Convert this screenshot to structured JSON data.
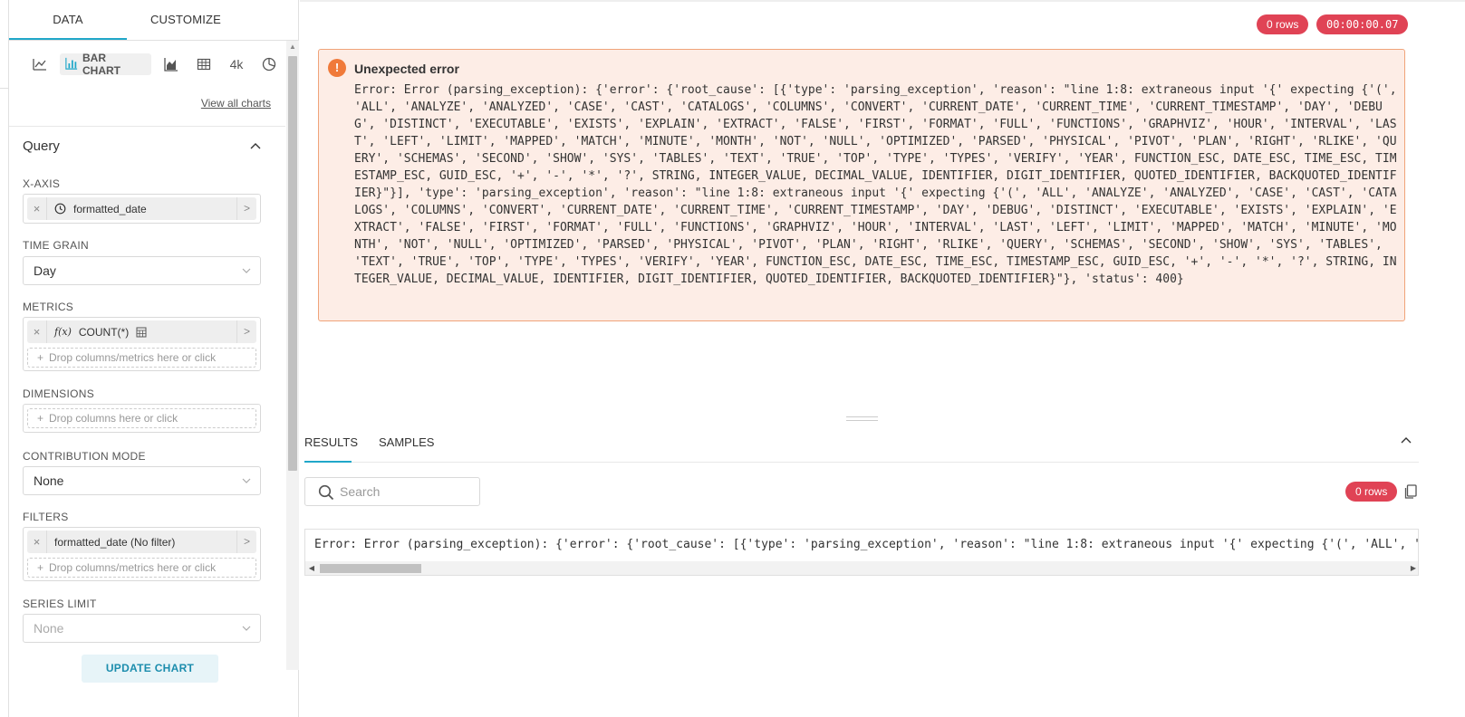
{
  "panel": {
    "tabs": [
      "DATA",
      "CUSTOMIZE"
    ],
    "chart_types": {
      "active_label": "BAR CHART",
      "four_k": "4k"
    },
    "view_all": "View all charts",
    "section_title": "Query",
    "x_axis": {
      "label": "X-AXIS",
      "value": "formatted_date"
    },
    "time_grain": {
      "label": "TIME GRAIN",
      "value": "Day"
    },
    "metrics": {
      "label": "METRICS",
      "fx": "f(x)",
      "value": "COUNT(*)",
      "drop": "Drop columns/metrics here or click"
    },
    "dimensions": {
      "label": "DIMENSIONS",
      "drop": "Drop columns here or click"
    },
    "contribution": {
      "label": "CONTRIBUTION MODE",
      "value": "None"
    },
    "filters": {
      "label": "FILTERS",
      "value": "formatted_date (No filter)",
      "drop": "Drop columns/metrics here or click"
    },
    "series_limit": {
      "label": "SERIES LIMIT",
      "placeholder": "None"
    },
    "update_button": "UPDATE CHART"
  },
  "header": {
    "rows_badge": "0 rows",
    "timer": "00:00:00.07"
  },
  "error": {
    "title": "Unexpected error",
    "message": "Error: Error (parsing_exception): {'error': {'root_cause': [{'type': 'parsing_exception', 'reason': \"line 1:8: extraneous input '{' expecting {'(', 'ALL', 'ANALYZE', 'ANALYZED', 'CASE', 'CAST', 'CATALOGS', 'COLUMNS', 'CONVERT', 'CURRENT_DATE', 'CURRENT_TIME', 'CURRENT_TIMESTAMP', 'DAY', 'DEBUG', 'DISTINCT', 'EXECUTABLE', 'EXISTS', 'EXPLAIN', 'EXTRACT', 'FALSE', 'FIRST', 'FORMAT', 'FULL', 'FUNCTIONS', 'GRAPHVIZ', 'HOUR', 'INTERVAL', 'LAST', 'LEFT', 'LIMIT', 'MAPPED', 'MATCH', 'MINUTE', 'MONTH', 'NOT', 'NULL', 'OPTIMIZED', 'PARSED', 'PHYSICAL', 'PIVOT', 'PLAN', 'RIGHT', 'RLIKE', 'QUERY', 'SCHEMAS', 'SECOND', 'SHOW', 'SYS', 'TABLES', 'TEXT', 'TRUE', 'TOP', 'TYPE', 'TYPES', 'VERIFY', 'YEAR', FUNCTION_ESC, DATE_ESC, TIME_ESC, TIMESTAMP_ESC, GUID_ESC, '+', '-', '*', '?', STRING, INTEGER_VALUE, DECIMAL_VALUE, IDENTIFIER, DIGIT_IDENTIFIER, QUOTED_IDENTIFIER, BACKQUOTED_IDENTIFIER}\"}], 'type': 'parsing_exception', 'reason': \"line 1:8: extraneous input '{' expecting {'(', 'ALL', 'ANALYZE', 'ANALYZED', 'CASE', 'CAST', 'CATALOGS', 'COLUMNS', 'CONVERT', 'CURRENT_DATE', 'CURRENT_TIME', 'CURRENT_TIMESTAMP', 'DAY', 'DEBUG', 'DISTINCT', 'EXECUTABLE', 'EXISTS', 'EXPLAIN', 'EXTRACT', 'FALSE', 'FIRST', 'FORMAT', 'FULL', 'FUNCTIONS', 'GRAPHVIZ', 'HOUR', 'INTERVAL', 'LAST', 'LEFT', 'LIMIT', 'MAPPED', 'MATCH', 'MINUTE', 'MONTH', 'NOT', 'NULL', 'OPTIMIZED', 'PARSED', 'PHYSICAL', 'PIVOT', 'PLAN', 'RIGHT', 'RLIKE', 'QUERY', 'SCHEMAS', 'SECOND', 'SHOW', 'SYS', 'TABLES', 'TEXT', 'TRUE', 'TOP', 'TYPE', 'TYPES', 'VERIFY', 'YEAR', FUNCTION_ESC, DATE_ESC, TIME_ESC, TIMESTAMP_ESC, GUID_ESC, '+', '-', '*', '?', STRING, INTEGER_VALUE, DECIMAL_VALUE, IDENTIFIER, DIGIT_IDENTIFIER, QUOTED_IDENTIFIER, BACKQUOTED_IDENTIFIER}\"}, 'status': 400}"
  },
  "results": {
    "tabs": [
      "RESULTS",
      "SAMPLES"
    ],
    "search_placeholder": "Search",
    "rows_badge": "0 rows",
    "error_line": "Error: Error (parsing_exception): {'error': {'root_cause': [{'type': 'parsing_exception', 'reason': \"line 1:8: extraneous input '{' expecting {'(', 'ALL', 'ANALYZE', 'ANALYZED', 'CASE'"
  },
  "colors": {
    "accent": "#20a7c9",
    "badge": "#e04355",
    "error_bg": "#fdede6",
    "error_border": "#f0a47a",
    "error_icon": "#f07a3a"
  },
  "icons": [
    "line-chart-icon",
    "bar-chart-icon",
    "area-chart-icon",
    "table-icon",
    "pie-chart-icon",
    "chevron-up-icon",
    "clock-icon",
    "function-icon",
    "calculator-icon",
    "chevron-down-icon",
    "search-icon",
    "copy-icon",
    "warning-icon"
  ]
}
